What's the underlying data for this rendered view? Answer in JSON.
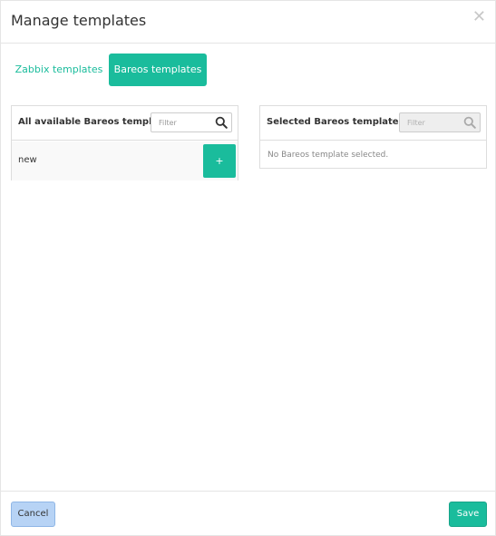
{
  "modal": {
    "title": "Manage templates",
    "close_icon": "close-icon"
  },
  "tabs": [
    {
      "label": "Zabbix templates",
      "active": false
    },
    {
      "label": "Bareos templates",
      "active": true
    }
  ],
  "available": {
    "title": "All available Bareos templates",
    "filter_placeholder": "Filter",
    "items": [
      {
        "name": "new",
        "add_label": "+"
      }
    ]
  },
  "selected": {
    "title": "Selected Bareos templates",
    "filter_placeholder": "Filter",
    "empty_message": "No Bareos template selected."
  },
  "footer": {
    "cancel_label": "Cancel",
    "save_label": "Save"
  },
  "colors": {
    "accent": "#1abc9c",
    "cancel_bg": "#b7d3f5"
  }
}
